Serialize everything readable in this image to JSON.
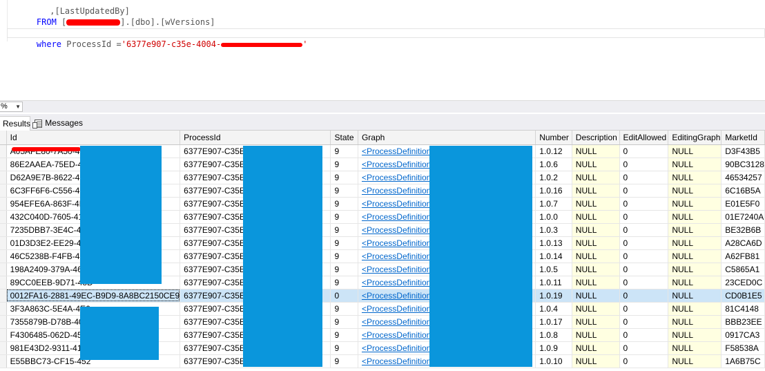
{
  "editor": {
    "line1": "      ,[LastUpdatedBy]",
    "from_kw": "FROM",
    "from_open": " [",
    "from_rest": "].[dbo].[wVersions]",
    "where_kw": "where",
    "where_mid": " ProcessId =",
    "where_value": "'6377e907-c35e-4004-",
    "where_value_tail": "'"
  },
  "zoom": {
    "value": "%"
  },
  "tabs": {
    "results": "Results",
    "messages": "Messages"
  },
  "grid": {
    "columns": [
      "Id",
      "ProcessId",
      "State",
      "Graph",
      "Number",
      "Description",
      "EditAllowed",
      "EditingGraph",
      "MarketId"
    ],
    "rows": [
      [
        "A05AFE80-7A50-4E7",
        "6377E907-C35E-400",
        "9",
        "<ProcessDefinition xm",
        "1.0.12",
        "NULL",
        "0",
        "NULL",
        "D3F43B5"
      ],
      [
        "86E2AAEA-75ED-4F",
        "6377E907-C35E-400",
        "9",
        "<ProcessDefinition xm",
        "1.0.6",
        "NULL",
        "0",
        "NULL",
        "90BC3128"
      ],
      [
        "D62A9E7B-8622-4E7",
        "6377E907-C35E-400",
        "9",
        "<ProcessDefinition xm",
        "1.0.2",
        "NULL",
        "0",
        "NULL",
        "46534257"
      ],
      [
        "6C3FF6F6-C556-4EB",
        "6377E907-C35E-400",
        "9",
        "<ProcessDefinition xm",
        "1.0.16",
        "NULL",
        "0",
        "NULL",
        "6C16B5A"
      ],
      [
        "954EFE6A-863F-4D0",
        "6377E907-C35E-400",
        "9",
        "<ProcessDefinition xm",
        "1.0.7",
        "NULL",
        "0",
        "NULL",
        "E01E5F0"
      ],
      [
        "432C040D-7605-412",
        "6377E907-C35E-400",
        "9",
        "<ProcessDefinition xm",
        "1.0.0",
        "NULL",
        "0",
        "NULL",
        "01E7240A"
      ],
      [
        "7235DBB7-3E4C-407",
        "6377E907-C35E-400",
        "9",
        "<ProcessDefinition xm",
        "1.0.3",
        "NULL",
        "0",
        "NULL",
        "BE32B6B"
      ],
      [
        "01D3D3E2-EE29-494",
        "6377E907-C35E-400",
        "9",
        "<ProcessDefinition xm",
        "1.0.13",
        "NULL",
        "0",
        "NULL",
        "A28CA6D"
      ],
      [
        "46C5238B-F4FB-4B2",
        "6377E907-C35E-400",
        "9",
        "<ProcessDefinition xm",
        "1.0.14",
        "NULL",
        "0",
        "NULL",
        "A62FB81"
      ],
      [
        "198A2409-379A-46E",
        "6377E907-C35E-400",
        "9",
        "<ProcessDefinition xm",
        "1.0.5",
        "NULL",
        "0",
        "NULL",
        "C5865A1"
      ],
      [
        "89CC0EEB-9D71-48D",
        "6377E907-C35E-400",
        "9",
        "<ProcessDefinition xm",
        "1.0.11",
        "NULL",
        "0",
        "NULL",
        "23CED0C"
      ],
      [
        "0012FA16-2881-49EC-B9D9-8A8BC2150CE9",
        "6377E907-C35E-400",
        "0",
        "<ProcessDefinition xm",
        "1.0.19",
        "NULL",
        "0",
        "NULL",
        "CD0B1E5"
      ],
      [
        "3F3A863C-5E4A-4E6",
        "6377E907-C35E-400",
        "9",
        "<ProcessDefinition xm",
        "1.0.4",
        "NULL",
        "0",
        "NULL",
        "81C4148"
      ],
      [
        "7355879B-D78B-40E",
        "6377E907-C35E-400",
        "9",
        "<ProcessDefinition xm",
        "1.0.17",
        "NULL",
        "0",
        "NULL",
        "BBB23EE"
      ],
      [
        "F4306485-062D-453",
        "6377E907-C35E-400",
        "9",
        "<ProcessDefinition xm",
        "1.0.8",
        "NULL",
        "0",
        "NULL",
        "0917CA3"
      ],
      [
        "981E43D2-9311-41E",
        "6377E907-C35E-400",
        "9",
        "<ProcessDefinition xm",
        "1.0.9",
        "NULL",
        "0",
        "NULL",
        "F58538A"
      ],
      [
        "E55BBC73-CF15-452",
        "6377E907-C35E-400",
        "9",
        "<ProcessDefinition xm",
        "1.0.10",
        "NULL",
        "0",
        "NULL",
        "1A6B75C"
      ]
    ],
    "selected_row": 11
  },
  "colors": {
    "redaction_blue": "#0a96dc",
    "redaction_red": "#ff0000",
    "keyword": "#0000ff",
    "string": "#d00000",
    "null_bg": "#ffffe1",
    "selection": "#cce4f7"
  }
}
